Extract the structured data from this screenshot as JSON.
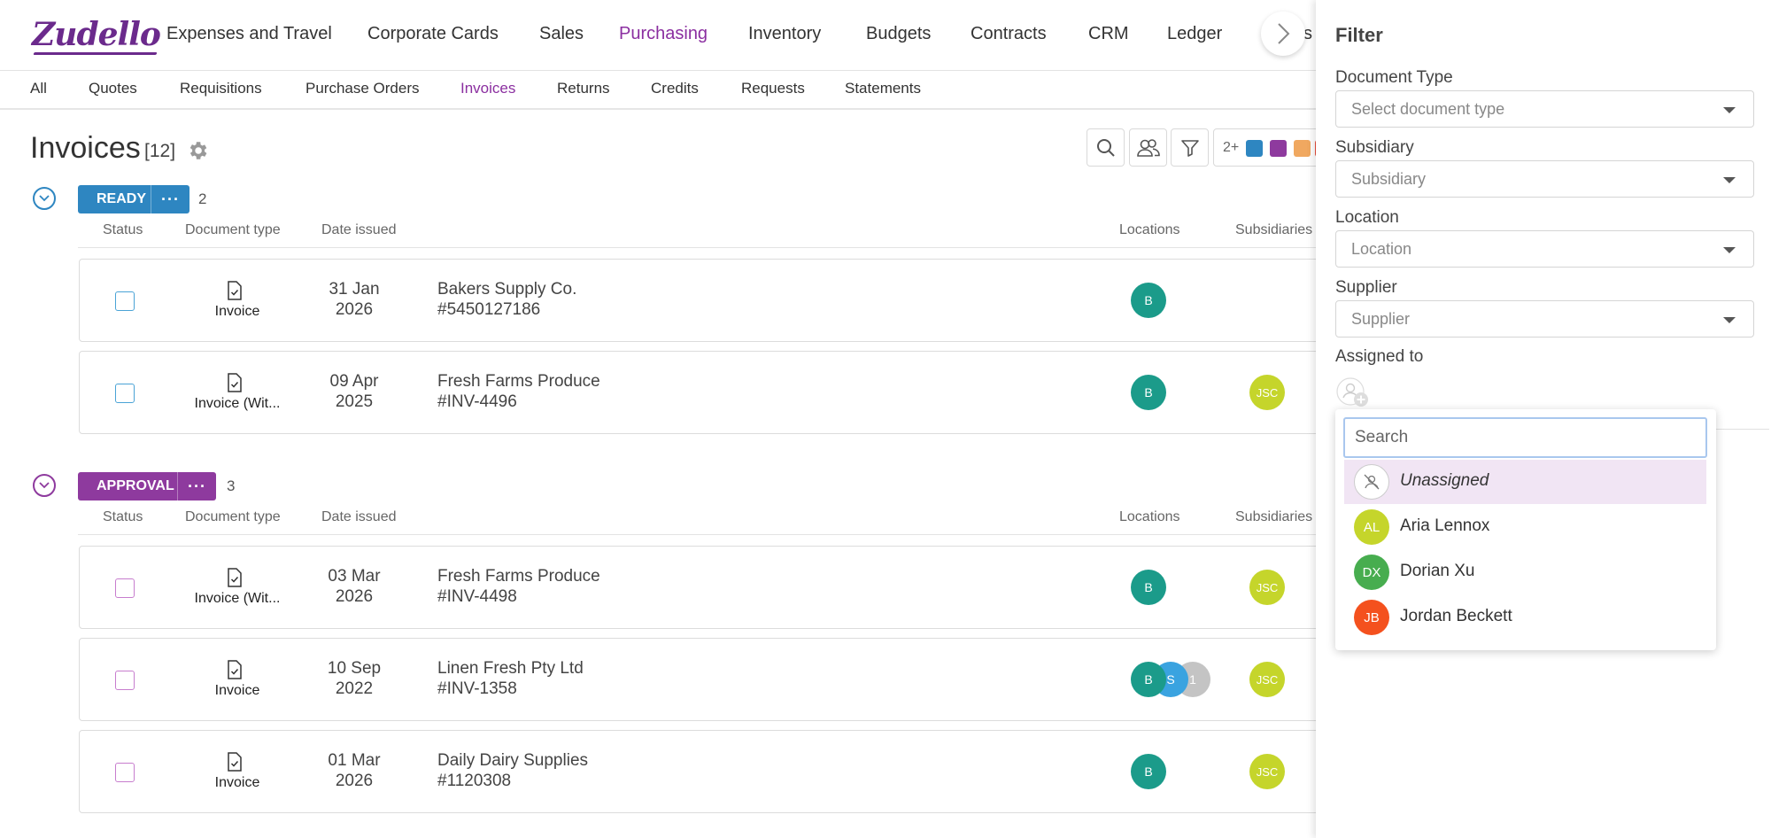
{
  "logo": "Zudello",
  "top_nav": {
    "items": [
      {
        "label": "Expenses and Travel",
        "active": false
      },
      {
        "label": "Corporate Cards",
        "active": false
      },
      {
        "label": "Sales",
        "active": false
      },
      {
        "label": "Purchasing",
        "active": true
      },
      {
        "label": "Inventory",
        "active": false
      },
      {
        "label": "Budgets",
        "active": false
      },
      {
        "label": "Contracts",
        "active": false
      },
      {
        "label": "CRM",
        "active": false
      },
      {
        "label": "Ledger",
        "active": false
      },
      {
        "label": "s",
        "active": false
      }
    ]
  },
  "sub_nav": {
    "items": [
      {
        "label": "All",
        "active": false
      },
      {
        "label": "Quotes",
        "active": false
      },
      {
        "label": "Requisitions",
        "active": false
      },
      {
        "label": "Purchase Orders",
        "active": false
      },
      {
        "label": "Invoices",
        "active": true
      },
      {
        "label": "Returns",
        "active": false
      },
      {
        "label": "Credits",
        "active": false
      },
      {
        "label": "Requests",
        "active": false
      },
      {
        "label": "Statements",
        "active": false
      }
    ]
  },
  "page": {
    "title": "Invoices",
    "count": "[12]",
    "color_filter_label": "2+",
    "color_chips": [
      "#2e86c1",
      "#8e3a9e",
      "#f0a860",
      "#e74c3c"
    ]
  },
  "columns": {
    "status": "Status",
    "doc_type": "Document type",
    "date_issued": "Date issued",
    "locations": "Locations",
    "subsidiaries": "Subsidiaries"
  },
  "groups": [
    {
      "name": "READY",
      "count": "2",
      "color": "#2e86c1",
      "rows": [
        {
          "doc_type": "Invoice",
          "date_line1": "31 Jan",
          "date_line2": "2026",
          "supplier": "Bakers Supply Co.",
          "ref": "#5450127186",
          "locations": [
            "B"
          ],
          "subsidiaries": []
        },
        {
          "doc_type": "Invoice (Wit...",
          "date_line1": "09 Apr",
          "date_line2": "2025",
          "supplier": "Fresh Farms Produce",
          "ref": "#INV-4496",
          "locations": [
            "B"
          ],
          "subsidiaries": [
            "JSC"
          ]
        }
      ]
    },
    {
      "name": "APPROVAL",
      "count": "3",
      "color": "#8e3a9e",
      "rows": [
        {
          "doc_type": "Invoice (Wit...",
          "date_line1": "03 Mar",
          "date_line2": "2026",
          "supplier": "Fresh Farms Produce",
          "ref": "#INV-4498",
          "locations": [
            "B"
          ],
          "subsidiaries": [
            "JSC"
          ]
        },
        {
          "doc_type": "Invoice",
          "date_line1": "10 Sep",
          "date_line2": "2022",
          "supplier": "Linen Fresh Pty Ltd",
          "ref": "#INV-1358",
          "locations": [
            "B",
            "S",
            "1"
          ],
          "subsidiaries": [
            "JSC"
          ]
        },
        {
          "doc_type": "Invoice",
          "date_line1": "01 Mar",
          "date_line2": "2026",
          "supplier": "Daily Dairy Supplies",
          "ref": "#1120308",
          "locations": [
            "B"
          ],
          "subsidiaries": [
            "JSC"
          ]
        }
      ]
    }
  ],
  "filter": {
    "title": "Filter",
    "document_type": {
      "label": "Document Type",
      "placeholder": "Select document type"
    },
    "subsidiary": {
      "label": "Subsidiary",
      "placeholder": "Subsidiary"
    },
    "location": {
      "label": "Location",
      "placeholder": "Location"
    },
    "supplier": {
      "label": "Supplier",
      "placeholder": "Supplier"
    },
    "assigned_to": {
      "label": "Assigned to"
    }
  },
  "assignee_dropdown": {
    "search_placeholder": "Search",
    "options": [
      {
        "initials": "",
        "name": "Unassigned",
        "color": "#ffffff",
        "highlighted": true
      },
      {
        "initials": "AL",
        "name": "Aria Lennox",
        "color": "#c5d52b",
        "highlighted": false
      },
      {
        "initials": "DX",
        "name": "Dorian Xu",
        "color": "#47ad4f",
        "highlighted": false
      },
      {
        "initials": "JB",
        "name": "Jordan Beckett",
        "color": "#f4511e",
        "highlighted": false
      }
    ]
  },
  "avatar_colors": {
    "B": "#1b9b8a",
    "S": "#3aa3e0",
    "1": "#c4c4c4",
    "JSC": "#c5d52b"
  }
}
